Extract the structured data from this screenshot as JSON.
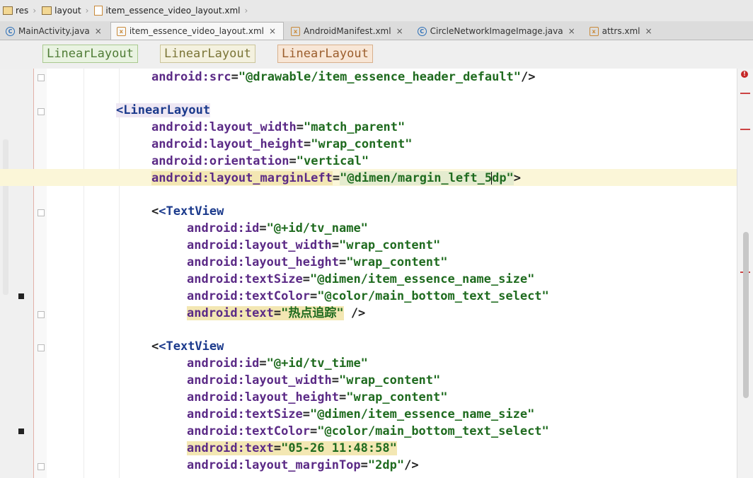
{
  "breadcrumb": [
    {
      "label": "res"
    },
    {
      "label": "layout"
    },
    {
      "label": "item_essence_video_layout.xml"
    }
  ],
  "tabs": [
    {
      "label": "MainActivity.java",
      "icon": "java-class-icon",
      "close": "×"
    },
    {
      "label": "item_essence_video_layout.xml",
      "icon": "xml-file-icon",
      "close": "×",
      "active": true
    },
    {
      "label": "AndroidManifest.xml",
      "icon": "xml-file-icon",
      "close": "×"
    },
    {
      "label": "CircleNetworkImageImage.java",
      "icon": "java-class-icon",
      "close": "×"
    },
    {
      "label": "attrs.xml",
      "icon": "xml-file-icon",
      "close": "×"
    }
  ],
  "tag_path": [
    "LinearLayout",
    "LinearLayout",
    "LinearLayout"
  ],
  "code": {
    "l1": {
      "ns": "android",
      "attr": ":src",
      "eq": "=",
      "val": "\"@drawable/item_essence_header_default\"",
      "end": "/>"
    },
    "l2": {
      "tag": "<LinearLayout"
    },
    "l3": {
      "ns": "android",
      "attr": ":layout_width",
      "eq": "=",
      "val": "\"match_parent\""
    },
    "l4": {
      "ns": "android",
      "attr": ":layout_height",
      "eq": "=",
      "val": "\"wrap_content\""
    },
    "l5": {
      "ns": "android",
      "attr": ":orientation",
      "eq": "=",
      "val": "\"vertical\""
    },
    "l6": {
      "ns": "android",
      "attr": ":layout_marginLeft",
      "eq": "=",
      "val_a": "\"@dimen/margin_left_5",
      "val_b": "dp\"",
      "end": ">"
    },
    "l7": {
      "tag": "<TextView"
    },
    "l8": {
      "ns": "android",
      "attr": ":id",
      "eq": "=",
      "val": "\"@+id/tv_name\""
    },
    "l9": {
      "ns": "android",
      "attr": ":layout_width",
      "eq": "=",
      "val": "\"wrap_content\""
    },
    "l10": {
      "ns": "android",
      "attr": ":layout_height",
      "eq": "=",
      "val": "\"wrap_content\""
    },
    "l11": {
      "ns": "android",
      "attr": ":textSize",
      "eq": "=",
      "val": "\"@dimen/item_essence_name_size\""
    },
    "l12": {
      "ns": "android",
      "attr": ":textColor",
      "eq": "=",
      "val": "\"@color/main_bottom_text_select\""
    },
    "l13": {
      "ns": "android",
      "attr": ":text",
      "eq": "=",
      "val": "\"热点追踪\"",
      "end": " />"
    },
    "l14": {
      "tag": "<TextView"
    },
    "l15": {
      "ns": "android",
      "attr": ":id",
      "eq": "=",
      "val": "\"@+id/tv_time\""
    },
    "l16": {
      "ns": "android",
      "attr": ":layout_width",
      "eq": "=",
      "val": "\"wrap_content\""
    },
    "l17": {
      "ns": "android",
      "attr": ":layout_height",
      "eq": "=",
      "val": "\"wrap_content\""
    },
    "l18": {
      "ns": "android",
      "attr": ":textSize",
      "eq": "=",
      "val": "\"@dimen/item_essence_name_size\""
    },
    "l19": {
      "ns": "android",
      "attr": ":textColor",
      "eq": "=",
      "val": "\"@color/main_bottom_text_select\""
    },
    "l20": {
      "ns": "android",
      "attr": ":text",
      "eq": "=",
      "val": "\"05-26 11:48:58\""
    },
    "l21": {
      "ns": "android",
      "attr": ":layout_marginTop",
      "eq": "=",
      "val": "\"2dp\"",
      "end": "/>"
    }
  },
  "colors": {
    "attr": "#5b2a86",
    "value": "#1f6b1f",
    "tag": "#1b3a8c"
  }
}
